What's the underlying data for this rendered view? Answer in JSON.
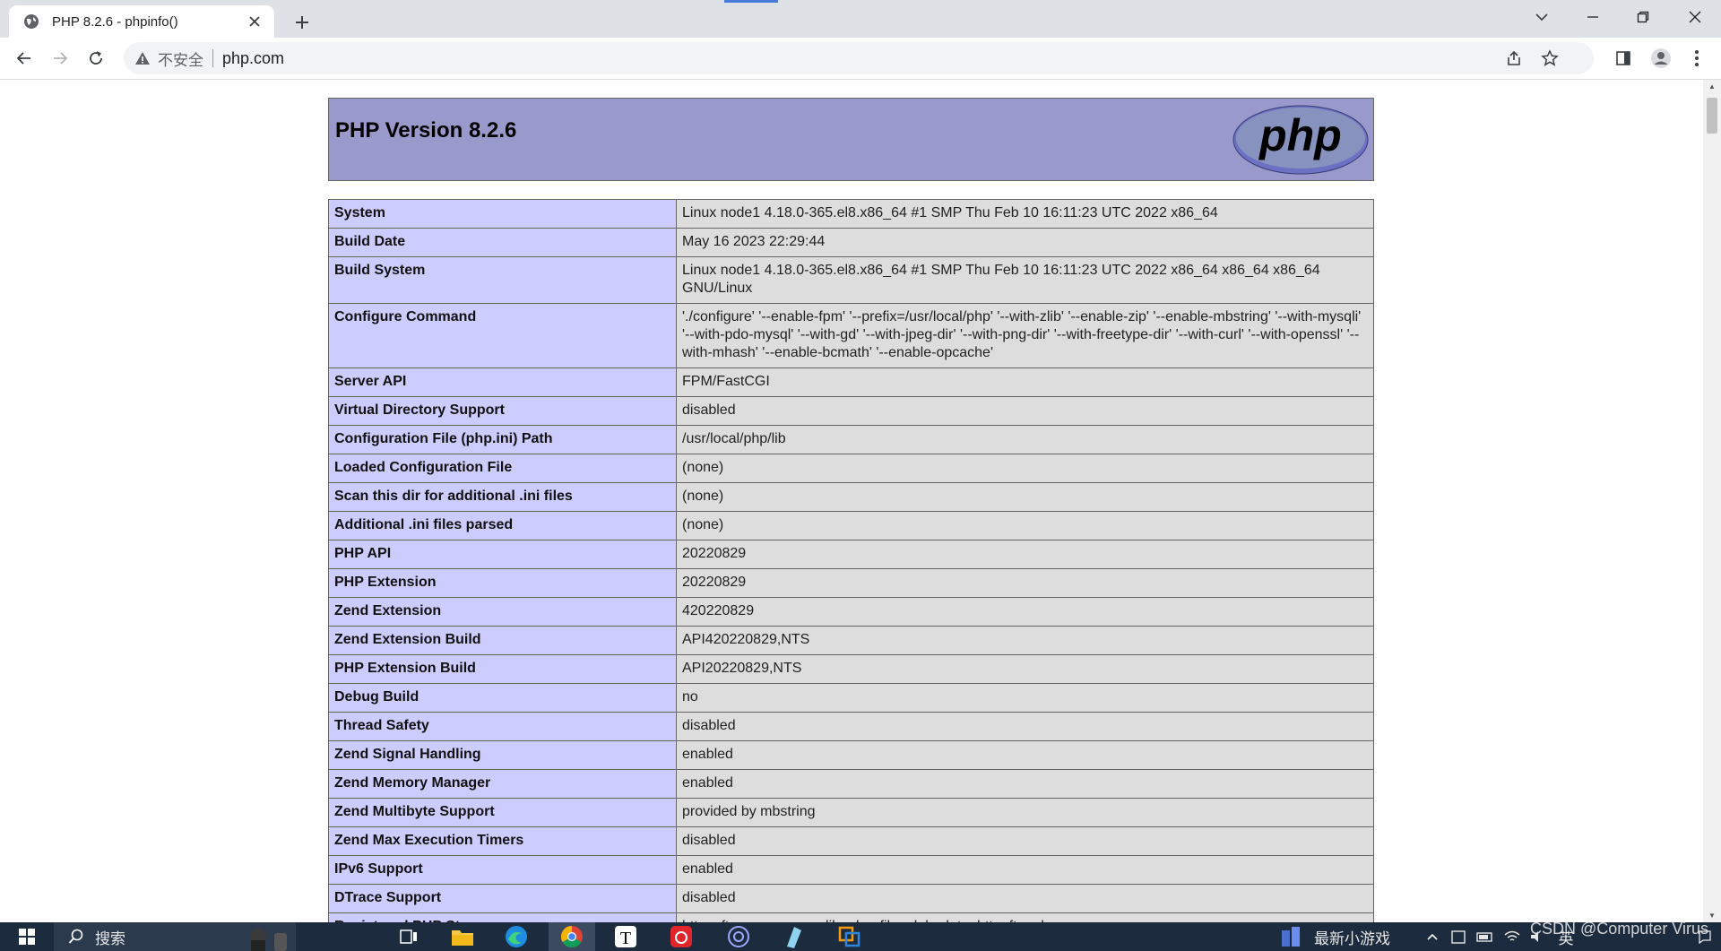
{
  "browser": {
    "tab_title": "PHP 8.2.6 - phpinfo()",
    "security_label": "不安全",
    "url": "php.com"
  },
  "page": {
    "heading": "PHP Version 8.2.6",
    "logo_text": "php",
    "rows": [
      {
        "key": "System",
        "value": "Linux node1 4.18.0-365.el8.x86_64 #1 SMP Thu Feb 10 16:11:23 UTC 2022 x86_64"
      },
      {
        "key": "Build Date",
        "value": "May 16 2023 22:29:44"
      },
      {
        "key": "Build System",
        "value": "Linux node1 4.18.0-365.el8.x86_64 #1 SMP Thu Feb 10 16:11:23 UTC 2022 x86_64 x86_64 x86_64 GNU/Linux"
      },
      {
        "key": "Configure Command",
        "value": "'./configure' '--enable-fpm' '--prefix=/usr/local/php' '--with-zlib' '--enable-zip' '--enable-mbstring' '--with-mysqli' '--with-pdo-mysql' '--with-gd' '--with-jpeg-dir' '--with-png-dir' '--with-freetype-dir' '--with-curl' '--with-openssl' '--with-mhash' '--enable-bcmath' '--enable-opcache'"
      },
      {
        "key": "Server API",
        "value": "FPM/FastCGI"
      },
      {
        "key": "Virtual Directory Support",
        "value": "disabled"
      },
      {
        "key": "Configuration File (php.ini) Path",
        "value": "/usr/local/php/lib"
      },
      {
        "key": "Loaded Configuration File",
        "value": "(none)"
      },
      {
        "key": "Scan this dir for additional .ini files",
        "value": "(none)"
      },
      {
        "key": "Additional .ini files parsed",
        "value": "(none)"
      },
      {
        "key": "PHP API",
        "value": "20220829"
      },
      {
        "key": "PHP Extension",
        "value": "20220829"
      },
      {
        "key": "Zend Extension",
        "value": "420220829"
      },
      {
        "key": "Zend Extension Build",
        "value": "API420220829,NTS"
      },
      {
        "key": "PHP Extension Build",
        "value": "API20220829,NTS"
      },
      {
        "key": "Debug Build",
        "value": "no"
      },
      {
        "key": "Thread Safety",
        "value": "disabled"
      },
      {
        "key": "Zend Signal Handling",
        "value": "enabled"
      },
      {
        "key": "Zend Memory Manager",
        "value": "enabled"
      },
      {
        "key": "Zend Multibyte Support",
        "value": "provided by mbstring"
      },
      {
        "key": "Zend Max Execution Timers",
        "value": "disabled"
      },
      {
        "key": "IPv6 Support",
        "value": "enabled"
      },
      {
        "key": "DTrace Support",
        "value": "disabled"
      },
      {
        "key": "Registered PHP Streams",
        "value": "https, ftps, compress.zlib, php, file, glob, data, http, ftp, phar"
      }
    ]
  },
  "taskbar": {
    "search_label": "搜索",
    "news_label": "最新小游戏",
    "ime_label": "英"
  },
  "watermark": "CSDN @Computer Virus"
}
